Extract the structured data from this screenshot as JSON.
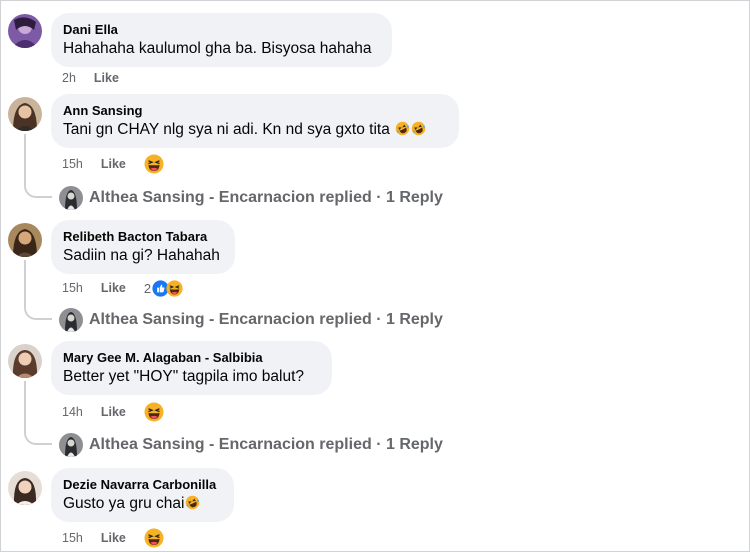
{
  "comments": [
    {
      "author": "Dani Ella",
      "text": "Hahahaha kaulumol gha ba. Bisyosa hahaha",
      "time": "2h",
      "like_label": "Like"
    },
    {
      "author": "Ann Sansing",
      "text": "Tani gn CHAY nlg sya ni adi. Kn nd sya gxto tita",
      "text_emojis": [
        "rofl",
        "rofl"
      ],
      "time": "15h",
      "like_label": "Like",
      "reaction": "laughing-emoji",
      "reply": {
        "author_line": "Althea Sansing - Encarnacion replied",
        "separator": "·",
        "count": "1 Reply"
      }
    },
    {
      "author": "Relibeth Bacton Tabara",
      "text": "Sadiin na gi? Hahahah",
      "time": "15h",
      "like_label": "Like",
      "reaction_count": "2",
      "reaction_icons": [
        "like",
        "laughing"
      ],
      "reply": {
        "author_line": "Althea Sansing - Encarnacion replied",
        "separator": "·",
        "count": "1 Reply"
      }
    },
    {
      "author": "Mary Gee M. Alagaban - Salbibia",
      "text": "Better yet \"HOY\" tagpila imo balut?",
      "time": "14h",
      "like_label": "Like",
      "reaction": "laughing-emoji",
      "reply": {
        "author_line": "Althea Sansing - Encarnacion replied",
        "separator": "·",
        "count": "1 Reply"
      }
    },
    {
      "author": "Dezie Navarra Carbonilla",
      "text": "Gusto ya gru chai",
      "text_emojis": [
        "rofl"
      ],
      "time": "15h",
      "like_label": "Like",
      "reaction": "laughing-emoji"
    }
  ],
  "colors": {
    "bubble": "#f0f2f5",
    "meta_text": "#65676b",
    "like_blue": "#1877f2",
    "emoji_yellow": "#f7b125"
  }
}
